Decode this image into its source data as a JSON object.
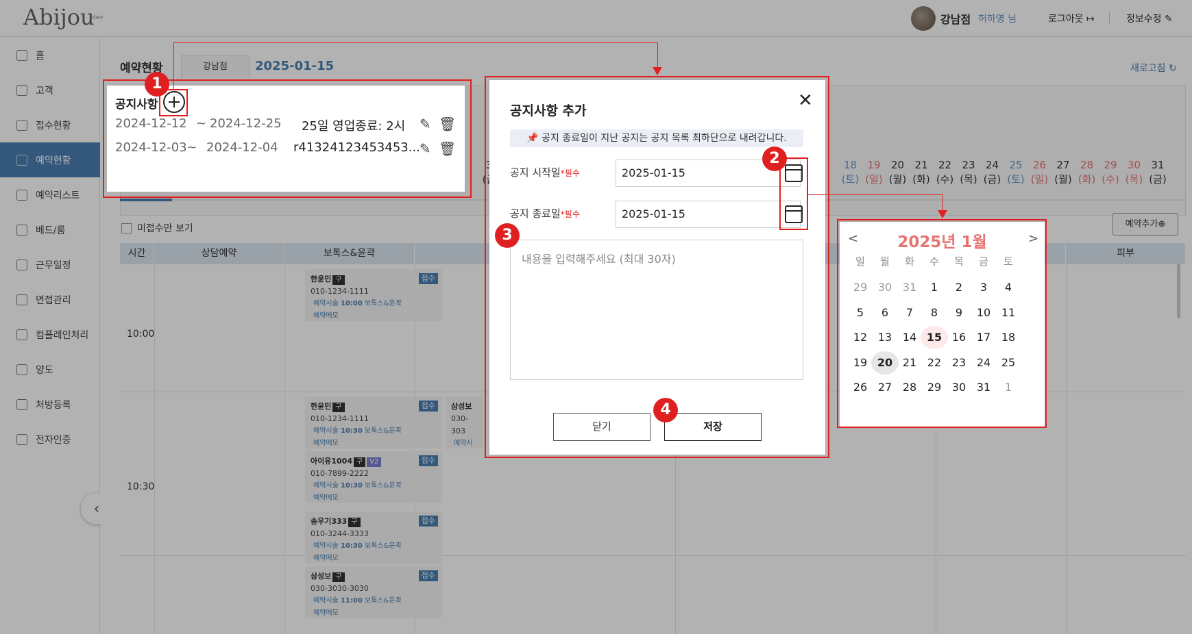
{
  "app": {
    "logo": "Abijou",
    "logo_tag": "dev"
  },
  "header": {
    "store": "강남점",
    "user": "허하영 님",
    "logout": "로그아웃",
    "edit_info": "정보수정"
  },
  "sidebar": {
    "items": [
      {
        "label": "홈",
        "icon": "home-icon"
      },
      {
        "label": "고객",
        "icon": "users-icon"
      },
      {
        "label": "접수현황",
        "icon": "reception-icon"
      },
      {
        "label": "예약현황",
        "icon": "calendar-icon"
      },
      {
        "label": "예약리스트",
        "icon": "list-icon"
      },
      {
        "label": "베드/룸",
        "icon": "bed-icon"
      },
      {
        "label": "근무일정",
        "icon": "schedule-icon"
      },
      {
        "label": "면접관리",
        "icon": "interview-icon"
      },
      {
        "label": "컴플레인처리",
        "icon": "smile-icon"
      },
      {
        "label": "양도",
        "icon": "transfer-icon"
      },
      {
        "label": "처방등록",
        "icon": "prescription-icon"
      },
      {
        "label": "전자인증",
        "icon": "document-icon"
      }
    ]
  },
  "main": {
    "title": "예약현황",
    "store_tab": "강남점",
    "date": "2025-01-15",
    "refresh": "새로고침",
    "unreceived_only": "미접수만 보기",
    "add_reservation": "예약추가",
    "date_strip": [
      {
        "d": "18",
        "w": "(토)",
        "c": "#6b95c9"
      },
      {
        "d": "19",
        "w": "(일)",
        "c": "#e87373"
      },
      {
        "d": "20",
        "w": "(월)",
        "c": "#333333"
      },
      {
        "d": "21",
        "w": "(화)",
        "c": "#333333"
      },
      {
        "d": "22",
        "w": "(수)",
        "c": "#333333"
      },
      {
        "d": "23",
        "w": "(목)",
        "c": "#333333"
      },
      {
        "d": "24",
        "w": "(금)",
        "c": "#333333"
      },
      {
        "d": "25",
        "w": "(토)",
        "c": "#6b95c9"
      },
      {
        "d": "26",
        "w": "(일)",
        "c": "#e87373"
      },
      {
        "d": "27",
        "w": "(월)",
        "c": "#333333"
      },
      {
        "d": "28",
        "w": "(화)",
        "c": "#e87373"
      },
      {
        "d": "29",
        "w": "(수)",
        "c": "#e87373"
      },
      {
        "d": "30",
        "w": "(목)",
        "c": "#e87373"
      },
      {
        "d": "31",
        "w": "(금)",
        "c": "#333333"
      }
    ],
    "strip_partial": {
      "d": "3",
      "w": "(금"
    },
    "grid_headers": [
      "시간",
      "상담예약",
      "보톡스&윤곽",
      "피부"
    ],
    "times": [
      "10:00",
      "10:30"
    ],
    "cards": [
      {
        "name": "한윤민",
        "badge": "구",
        "badge2": "",
        "status": "접수",
        "phone": "010-1234-1111",
        "time": "10:00",
        "proc": "보톡스&윤곽",
        "memo": "예약메모"
      },
      {
        "name": "한윤민",
        "badge": "구",
        "badge2": "",
        "status": "접수",
        "phone": "010-1234-1111",
        "time": "10:30",
        "proc": "보톡스&윤곽",
        "memo": "예약메모"
      },
      {
        "name": "아이유1004",
        "badge": "구",
        "badge2": "V2",
        "status": "접수",
        "phone": "010-7899-2222",
        "time": "10:30",
        "proc": "보톡스&윤곽",
        "memo": "예약메모"
      },
      {
        "name": "송우기333",
        "badge": "구",
        "badge2": "",
        "status": "접수",
        "phone": "010-3244-3333",
        "time": "10:30",
        "proc": "보톡스&윤곽",
        "memo": "예약메모"
      },
      {
        "name": "삼성보",
        "badge": "구",
        "badge2": "",
        "status": "접수",
        "phone": "030-3030-3030",
        "time": "11:00",
        "proc": "보톡스&윤곽",
        "memo": "예약메모"
      }
    ],
    "side_card": {
      "name": "삼성보",
      "phone": "030-303",
      "line": "예약시술",
      "line2": "예약메"
    },
    "reserve_label": "예약시술"
  },
  "notice": {
    "title": "공지사항",
    "items": [
      {
        "start": "2024-12-12",
        "sep": "~",
        "end": "2024-12-25",
        "text": "25일 영업종료: 2시"
      },
      {
        "start": "2024-12-03~",
        "sep": "",
        "end": "2024-12-04",
        "text": "r41324123453453..."
      }
    ]
  },
  "modal": {
    "title": "공지사항 추가",
    "info": "📌 공지 종료일이 지난 공지는 공지 목록 최하단으로 내려갑니다.",
    "start_label": "공지 시작일",
    "end_label": "공지 종료일",
    "required": "*필수",
    "start_value": "2025-01-15",
    "end_value": "2025-01-15",
    "content_placeholder": "내용을 입력해주세요 (최대 30자)",
    "close_btn": "닫기",
    "save_btn": "저장"
  },
  "calendar": {
    "title": "2025년 1월",
    "prev": "<",
    "next": ">",
    "weekdays": [
      "일",
      "월",
      "화",
      "수",
      "목",
      "금",
      "토"
    ],
    "weeks": [
      [
        "29",
        "30",
        "31",
        "1",
        "2",
        "3",
        "4"
      ],
      [
        "5",
        "6",
        "7",
        "8",
        "9",
        "10",
        "11"
      ],
      [
        "12",
        "13",
        "14",
        "15",
        "16",
        "17",
        "18"
      ],
      [
        "19",
        "20",
        "21",
        "22",
        "23",
        "24",
        "25"
      ],
      [
        "26",
        "27",
        "28",
        "29",
        "30",
        "31",
        "1"
      ]
    ],
    "other_month": [
      [
        0,
        0
      ],
      [
        0,
        1
      ],
      [
        0,
        2
      ],
      [
        4,
        6
      ]
    ],
    "today": "15",
    "selected": "20"
  },
  "annotations": [
    "1",
    "2",
    "3",
    "4"
  ],
  "colors": {
    "accent": "#4a7fb0",
    "annotation": "#e02020",
    "calendar_title": "#e87373"
  }
}
